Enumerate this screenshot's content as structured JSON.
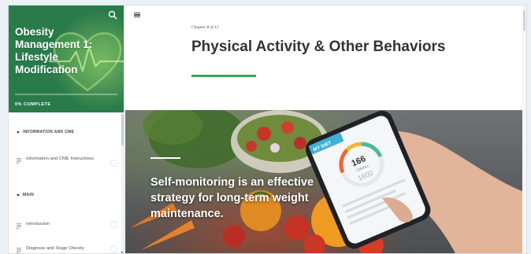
{
  "sidebar": {
    "course_title": "Obesity Management 1: Lifestyle Modification",
    "progress_text": "0% COMPLETE",
    "progress_value": 0,
    "header_color": "#2a7b4a",
    "search_icon": "search-icon",
    "sections": [
      {
        "title": "INFORMATION AND CME",
        "items": [
          {
            "label": "Information and CME Instructions"
          }
        ]
      },
      {
        "title": "MAIN",
        "items": [
          {
            "label": "Introduction"
          },
          {
            "label": "Diagnose and Stage Obesity"
          }
        ]
      }
    ]
  },
  "main": {
    "menu_icon": "menu-icon",
    "chapter_label": "Chapter 8 of 12",
    "lesson_title": "Physical Activity & Other Behaviors",
    "accent_color": "#3aa655",
    "hero": {
      "text": "Self-monitoring is an effective strategy for long-term weight maintenance.",
      "phone": {
        "app_label": "MY DIET",
        "calories_value": "166",
        "calories_label": "Calories",
        "calories_goal": "1600"
      }
    }
  }
}
